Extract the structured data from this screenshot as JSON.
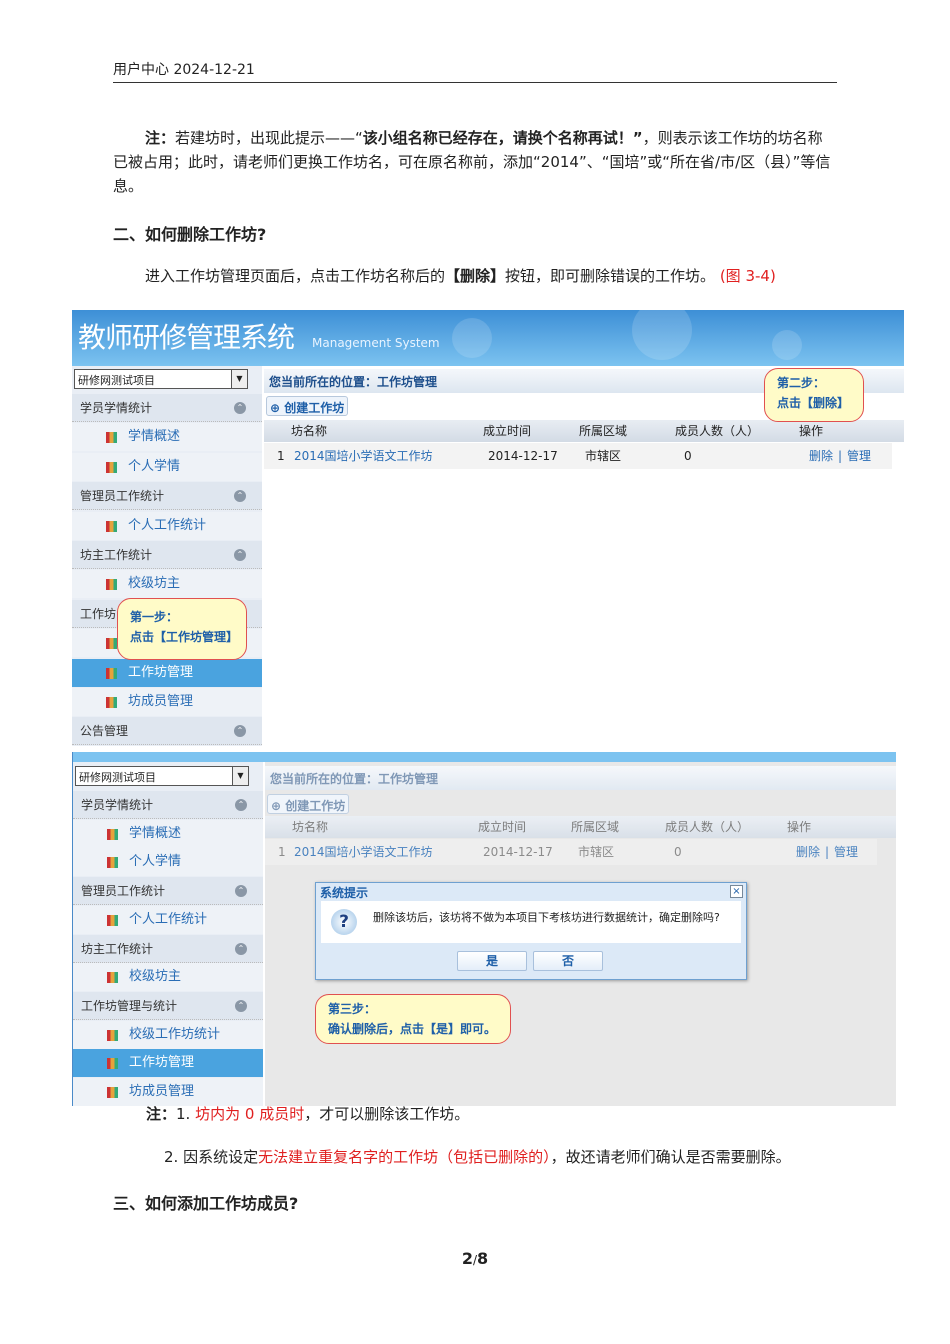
{
  "header": {
    "title": "用户中心 2024-12-21"
  },
  "note1": {
    "label": "注：",
    "a": "若建坊时，出现此提示——“",
    "bold": "该小组名称已经存在，请换个名称再试！”",
    "b": "，则表示该工作坊的坊名称已被占用；此时，请老师们更换工作坊名，可在原名称前，添加“2014”、“国培”或“所在省/市/区（县）”等信息。"
  },
  "section2": {
    "title": "二、如何删除工作坊?",
    "intro_a": "进入工作坊管理页面后，点击工作坊名称后的",
    "intro_bold": "【删除】",
    "intro_b": "按钮，即可删除错误的工作坊。",
    "figref": "(图 3-4)"
  },
  "app": {
    "title": "教师研修管理系统",
    "subtitle": "Management System",
    "project": "研修网测试项目",
    "breadcrumb": "您当前所在的位置：工作坊管理",
    "create_button": "创建工作坊",
    "columns": [
      "坊名称",
      "成立时间",
      "所属区域",
      "成员人数（人）",
      "操作"
    ],
    "row": {
      "index": "1",
      "name": "2014国培小学语文工作坊",
      "date": "2014-12-17",
      "area": "市辖区",
      "members": "0",
      "delete": "删除",
      "sep": "|",
      "manage": "管理"
    }
  },
  "sidebar_top": [
    {
      "type": "g",
      "label": "学员学情统计"
    },
    {
      "type": "i",
      "label": "学情概述"
    },
    {
      "type": "i",
      "label": "个人学情"
    },
    {
      "type": "g",
      "label": "管理员工作统计"
    },
    {
      "type": "i",
      "label": "个人工作统计"
    },
    {
      "type": "g",
      "label": "坊主工作统计"
    },
    {
      "type": "i",
      "label": "校级坊主"
    },
    {
      "type": "g",
      "label": "工作坊"
    },
    {
      "type": "i",
      "label": ""
    },
    {
      "type": "i",
      "label": "工作坊管理",
      "active": true
    },
    {
      "type": "i",
      "label": "坊成员管理"
    },
    {
      "type": "g",
      "label": "公告管理"
    }
  ],
  "sidebar_bottom": [
    {
      "type": "g",
      "label": "学员学情统计"
    },
    {
      "type": "i",
      "label": "学情概述"
    },
    {
      "type": "i",
      "label": "个人学情"
    },
    {
      "type": "g",
      "label": "管理员工作统计"
    },
    {
      "type": "i",
      "label": "个人工作统计"
    },
    {
      "type": "g",
      "label": "坊主工作统计"
    },
    {
      "type": "i",
      "label": "校级坊主"
    },
    {
      "type": "g",
      "label": "工作坊管理与统计"
    },
    {
      "type": "i",
      "label": "校级工作坊统计"
    },
    {
      "type": "i",
      "label": "工作坊管理",
      "active": true
    },
    {
      "type": "i",
      "label": "坊成员管理"
    }
  ],
  "callouts": {
    "step1_title": "第一步：",
    "step1_body": "点击【工作坊管理】",
    "step2_title": "第二步：",
    "step2_body": "点击【删除】",
    "step3_title": "第三步：",
    "step3_body": "确认删除后，点击【是】即可。"
  },
  "dialog": {
    "title": "系统提示",
    "message": "删除该坊后，该坊将不做为本项目下考核坊进行数据统计，确定删除吗?",
    "yes": "是",
    "no": "否",
    "close": "×"
  },
  "notes": {
    "label": "注：",
    "n1_num": "1.",
    "n1_red": "坊内为 0 成员时",
    "n1_rest": "，才可以删除该工作坊。",
    "n2_num": "2. 因系统设定",
    "n2_red": "无法建立重复名字的工作坊（包括已删除的）",
    "n2_rest": "，故还请老师们确认是否需要删除。"
  },
  "section3": {
    "title": "三、如何添加工作坊成员?"
  },
  "page": {
    "current": "2",
    "sep": "/",
    "total": "8"
  }
}
